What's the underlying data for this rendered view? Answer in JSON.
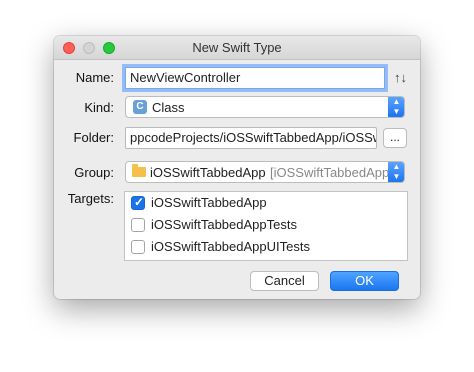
{
  "window": {
    "title": "New Swift Type"
  },
  "form": {
    "name_label": "Name:",
    "name_value": "NewViewController",
    "sort_icon_glyph": "↑↓",
    "kind_label": "Kind:",
    "kind_icon_letter": "C",
    "kind_value": "Class",
    "folder_label": "Folder:",
    "folder_value": "ppcodeProjects/iOSSwiftTabbedApp/iOSSw",
    "browse_label": "...",
    "group_label": "Group:",
    "group_value": "iOSSwiftTabbedApp",
    "group_path": "[iOSSwiftTabbedApp",
    "targets_label": "Targets:",
    "targets": [
      {
        "name": "iOSSwiftTabbedApp",
        "checked": true
      },
      {
        "name": "iOSSwiftTabbedAppTests",
        "checked": false
      },
      {
        "name": "iOSSwiftTabbedAppUITests",
        "checked": false
      }
    ]
  },
  "buttons": {
    "cancel": "Cancel",
    "ok": "OK"
  },
  "colors": {
    "accent": "#1a73e8",
    "close": "#ff5f57",
    "zoom": "#28c840",
    "minimize_disabled": "#d4d4d4"
  },
  "icons": [
    "close-icon",
    "minimize-icon",
    "zoom-icon",
    "sort-icon",
    "class-icon",
    "folder-icon",
    "chevron-up-down-icon",
    "checkmark-icon"
  ]
}
